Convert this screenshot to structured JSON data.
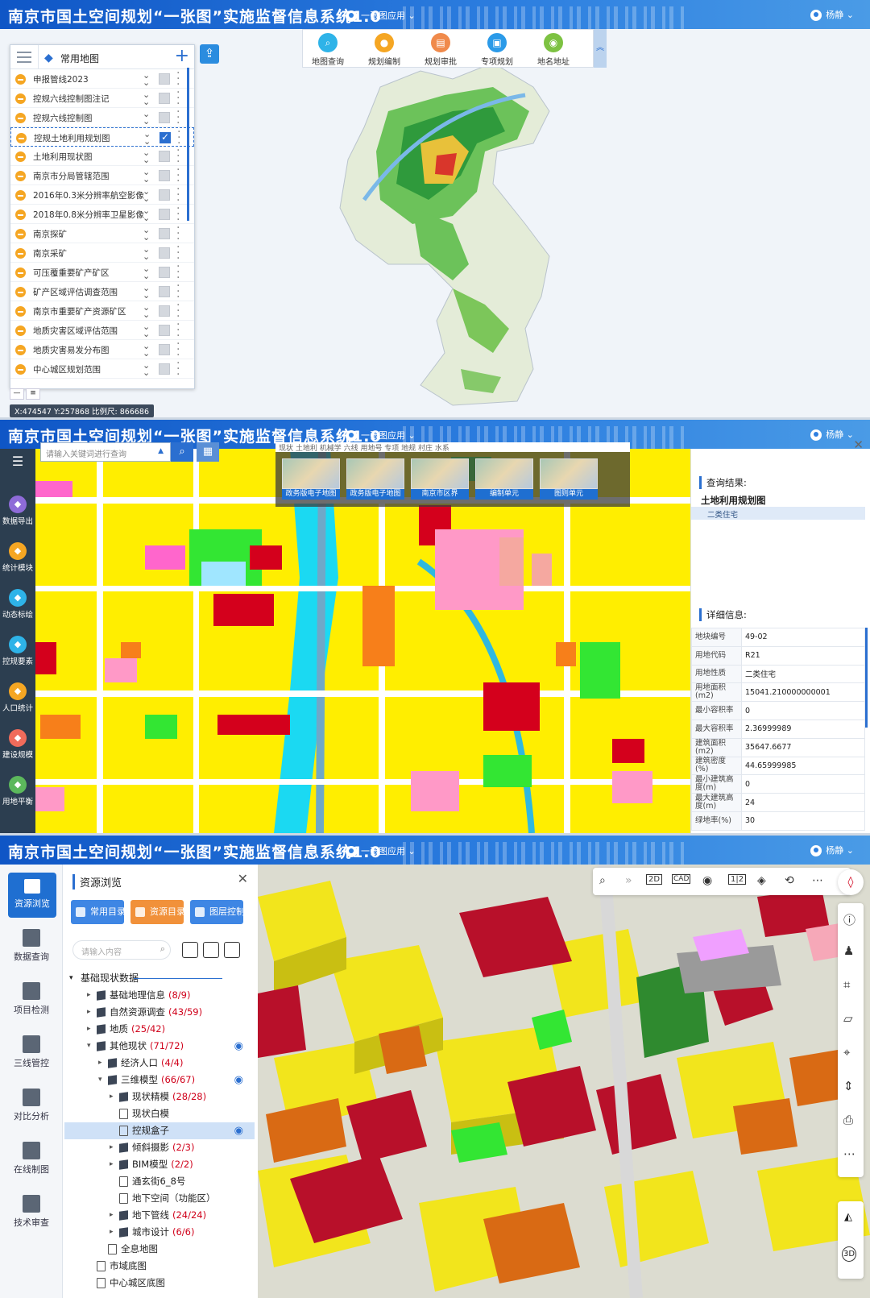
{
  "header": {
    "title": "南京市国土空间规划“一张图”实施监督信息系统1.0",
    "app_menu": "一张图应用",
    "user": "杨静"
  },
  "panel1": {
    "layer_tab": "常用地图",
    "layers": [
      {
        "name": "申报管线2023",
        "checked": false
      },
      {
        "name": "控规六线控制图注记",
        "checked": false
      },
      {
        "name": "控规六线控制图",
        "checked": false
      },
      {
        "name": "控规土地利用规划图",
        "checked": true
      },
      {
        "name": "土地利用现状图",
        "checked": false
      },
      {
        "name": "南京市分局管辖范围",
        "checked": false
      },
      {
        "name": "2016年0.3米分辨率航空影像",
        "checked": false
      },
      {
        "name": "2018年0.8米分辨率卫星影像",
        "checked": false
      },
      {
        "name": "南京探矿",
        "checked": false
      },
      {
        "name": "南京采矿",
        "checked": false
      },
      {
        "name": "可压覆重要矿产矿区",
        "checked": false
      },
      {
        "name": "矿产区域评估调查范围",
        "checked": false
      },
      {
        "name": "南京市重要矿产资源矿区",
        "checked": false
      },
      {
        "name": "地质灾害区域评估范围",
        "checked": false
      },
      {
        "name": "地质灾害易发分布图",
        "checked": false
      },
      {
        "name": "中心城区规划范围",
        "checked": false
      }
    ],
    "tools": [
      {
        "label": "地图查询",
        "icon": "search-icon",
        "color": "#2eb3e8"
      },
      {
        "label": "规划编制",
        "icon": "person-icon",
        "color": "#f5a623"
      },
      {
        "label": "规划审批",
        "icon": "document-icon",
        "color": "#f08a4b"
      },
      {
        "label": "专项规划",
        "icon": "folder-search-icon",
        "color": "#2b9ae8"
      },
      {
        "label": "地名地址",
        "icon": "location-pin-icon",
        "color": "#7dc242"
      }
    ],
    "coords": "X:474547 Y:257868 比例尺: 866686"
  },
  "panel2": {
    "search_placeholder": "请输入关键词进行查询",
    "left_tools": [
      "数据导出",
      "统计模块",
      "动态标绘",
      "控规要素",
      "人口统计",
      "建设规模",
      "用地平衡"
    ],
    "left_tool_colors": [
      "#8e6bd8",
      "#f5a623",
      "#2eb3e8",
      "#2eb3e8",
      "#f5a623",
      "#f06b5b",
      "#5cb85c"
    ],
    "basemap_tabs_text": "现状  土地利  机械学  六线  用地号  专项  地规  村庄  水系",
    "basemaps": [
      "政务版电子地图",
      "政务版电子地图",
      "南京市区界",
      "编制单元",
      "图则单元"
    ],
    "query_label": "查询结果:",
    "query_layer": "土地利用规划图",
    "query_item": "二类住宅",
    "detail_label": "详细信息:",
    "details": [
      {
        "k": "地块编号",
        "v": "49-02"
      },
      {
        "k": "用地代码",
        "v": "R21"
      },
      {
        "k": "用地性质",
        "v": "二类住宅"
      },
      {
        "k": "用地面积(m2)",
        "v": "15041.210000000001"
      },
      {
        "k": "最小容积率",
        "v": "0"
      },
      {
        "k": "最大容积率",
        "v": "2.36999989"
      },
      {
        "k": "建筑面积(m2)",
        "v": "35647.6677"
      },
      {
        "k": "建筑密度(%)",
        "v": "44.65999985"
      },
      {
        "k": "最小建筑高度(m)",
        "v": "0"
      },
      {
        "k": "最大建筑高度(m)",
        "v": "24"
      },
      {
        "k": "绿地率(%)",
        "v": "30"
      }
    ]
  },
  "panel3": {
    "nav": [
      "资源浏览",
      "数据查询",
      "项目检测",
      "三线管控",
      "对比分析",
      "在线制图",
      "技术审查"
    ],
    "panel_title": "资源浏览",
    "pills": [
      "常用目录",
      "资源目录",
      "图层控制"
    ],
    "search_placeholder": "请输入内容",
    "section": "基础现状数据",
    "tree": [
      {
        "label": "基础地理信息",
        "count": "(8/9)",
        "level": 1,
        "type": "cube",
        "arrow": "▸",
        "eye": false
      },
      {
        "label": "自然资源调查",
        "count": "(43/59)",
        "level": 1,
        "type": "cube",
        "arrow": "▸",
        "eye": false
      },
      {
        "label": "地质",
        "count": "(25/42)",
        "level": 1,
        "type": "cube",
        "arrow": "▸",
        "eye": false
      },
      {
        "label": "其他现状",
        "count": "(71/72)",
        "level": 1,
        "type": "cube",
        "arrow": "▾",
        "eye": true
      },
      {
        "label": "经济人口",
        "count": "(4/4)",
        "level": 2,
        "type": "cube",
        "arrow": "▸",
        "eye": false
      },
      {
        "label": "三维模型",
        "count": "(66/67)",
        "level": 2,
        "type": "cube",
        "arrow": "▾",
        "eye": true
      },
      {
        "label": "现状精模",
        "count": "(28/28)",
        "level": 3,
        "type": "cube",
        "arrow": "▸",
        "eye": false
      },
      {
        "label": "现状白模",
        "count": "",
        "level": 3,
        "type": "doc",
        "arrow": "",
        "eye": false
      },
      {
        "label": "控规盒子",
        "count": "",
        "level": 3,
        "type": "doc",
        "arrow": "",
        "eye": true,
        "hl": true
      },
      {
        "label": "倾斜摄影",
        "count": "(2/3)",
        "level": 3,
        "type": "cube",
        "arrow": "▸",
        "eye": false
      },
      {
        "label": "BIM模型",
        "count": "(2/2)",
        "level": 3,
        "type": "cube",
        "arrow": "▸",
        "eye": false
      },
      {
        "label": "通玄街6_8号",
        "count": "",
        "level": 3,
        "type": "doc",
        "arrow": "",
        "eye": false
      },
      {
        "label": "地下空间（功能区）",
        "count": "",
        "level": 3,
        "type": "doc",
        "arrow": "",
        "eye": false
      },
      {
        "label": "地下管线",
        "count": "(24/24)",
        "level": 3,
        "type": "cube",
        "arrow": "▸",
        "eye": false
      },
      {
        "label": "城市设计",
        "count": "(6/6)",
        "level": 3,
        "type": "cube",
        "arrow": "▸",
        "eye": false
      },
      {
        "label": "全息地图",
        "count": "",
        "level": 2,
        "type": "doc",
        "arrow": "",
        "eye": false
      },
      {
        "label": "市域底图",
        "count": "",
        "level": 1,
        "type": "doc",
        "arrow": "",
        "eye": false
      },
      {
        "label": "中心城区底图",
        "count": "",
        "level": 1,
        "type": "doc",
        "arrow": "",
        "eye": false
      }
    ],
    "toolbar_icons": [
      "search-icon",
      "double-chevron-icon",
      "2d-icon",
      "cad-icon",
      "eye-icon",
      "split-icon",
      "layers-icon",
      "rotate-icon",
      "more-icon"
    ],
    "toolbar_2d": "2D",
    "toolbar_cad": "CAD",
    "toolbar_split": "1|2",
    "side_icons": [
      "alert-icon",
      "walk-icon",
      "crop-icon",
      "measure-icon",
      "location-icon",
      "split-arrows-icon",
      "print-icon",
      "more-icon"
    ],
    "view_3d": "3D"
  }
}
